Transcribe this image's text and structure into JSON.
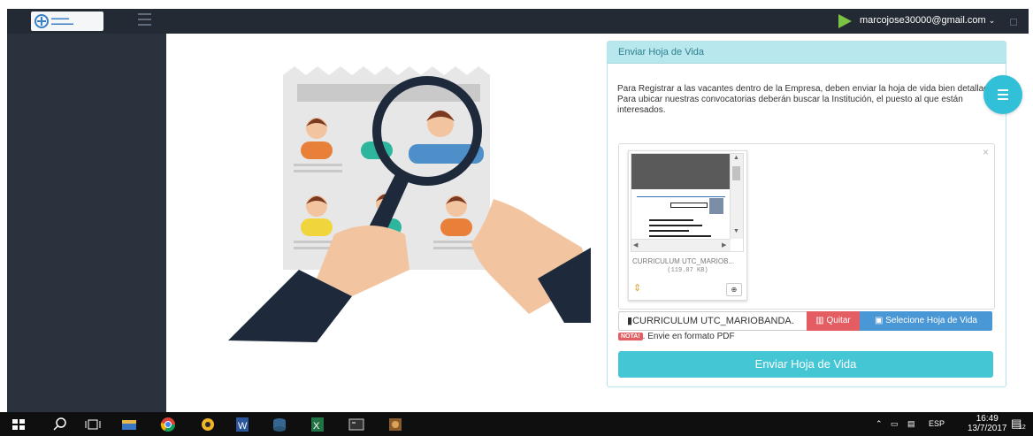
{
  "topbar": {
    "user_email": "marcojose30000@gmail.com",
    "caret": "⌄"
  },
  "panel": {
    "title": "Enviar Hoja de Vida",
    "paragraph_1": "Para Registrar a las vacantes dentro de la Empresa, deben enviar la hoja de vida bien detallada.",
    "paragraph_2": "Para ubicar nuestras convocatorias deberán buscar la Institución, el puesto al que están interesados."
  },
  "file_preview": {
    "file_name": "CURRICULUM UTC_MARIOB...",
    "file_size": "(119.07 KB)",
    "close": "×"
  },
  "file_input": {
    "caption": "CURRICULUM UTC_MARIOBANDA.",
    "remove_label": "Quitar",
    "select_label": "Selecione Hoja de Vida"
  },
  "note": {
    "badge": "NOTA!",
    "text": ". Envie en formato PDF"
  },
  "submit_label": "Enviar Hoja de Vida",
  "taskbar": {
    "language": "ESP",
    "time": "16:49",
    "date": "13/7/2017",
    "notification_count": "12"
  },
  "colors": {
    "topbar": "#232a33",
    "sidebar": "#2a333d",
    "panel_header": "#b8e7ee",
    "submit": "#45c6d5",
    "danger": "#e35d62",
    "primary": "#4a97d6",
    "accent_green": "#7cc242"
  },
  "icons": [
    "menu-icon",
    "play-icon",
    "chevron-down-icon",
    "file-icon",
    "trash-icon",
    "image-icon",
    "zoom-in-icon",
    "move-icon",
    "windows-icon",
    "search-icon",
    "task-view-icon",
    "file-explorer-icon",
    "chrome-icon",
    "word-icon",
    "excel-icon",
    "terminal-icon",
    "network-icon",
    "volume-icon",
    "notification-icon"
  ]
}
